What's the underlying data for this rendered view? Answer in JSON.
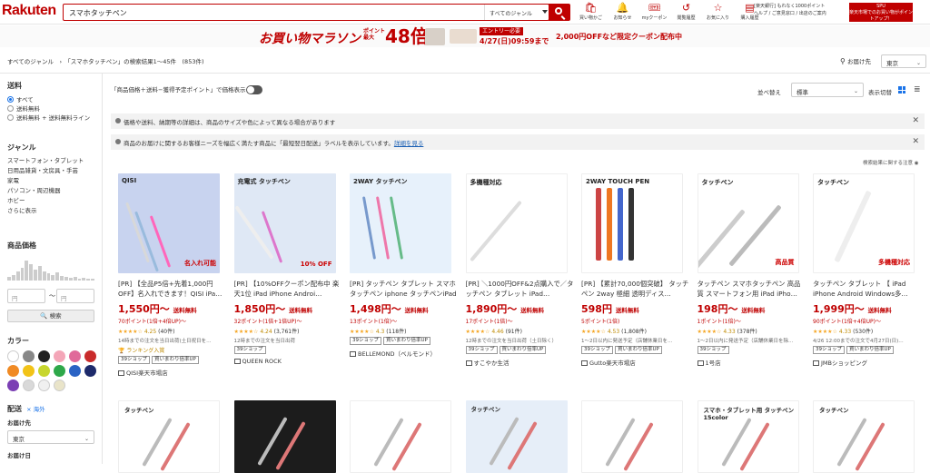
{
  "header": {
    "logo": "Rakuten",
    "search_value": "スマホタッチペン",
    "genre_select": "すべてのジャンル",
    "icons": [
      {
        "name": "purchase-history-icon",
        "glyph": "🛍",
        "label": "買い物かご"
      },
      {
        "name": "bell-icon",
        "glyph": "🔔",
        "label": "お知らせ"
      },
      {
        "name": "coupon-icon",
        "glyph": "🎟",
        "label": "myクーポン"
      },
      {
        "name": "history-icon",
        "glyph": "↺",
        "label": "閲覧履歴"
      },
      {
        "name": "star-icon",
        "glyph": "☆",
        "label": "お気に入り"
      },
      {
        "name": "receipt-icon",
        "glyph": "▤",
        "label": "購入履歴"
      }
    ],
    "links_line1": "[楽天銀行] もれなく1000ポイント",
    "links_line2": "ヘルプ / ご意見窓口 / 出店のご案内",
    "banner": "楽天市場でのお買い物がポイントアップ！",
    "banner_top": "SPU"
  },
  "promo": {
    "title": "お買い物マラソン",
    "point_label1": "ポイント",
    "point_label2": "最大",
    "big": "48倍",
    "entry": "エントリー必要",
    "deadline": "4/27(日)09:59まで",
    "coupon": "2,000円OFFなど限定クーポン配布中"
  },
  "breadcrumb": "すべてのジャンル　›　「スマホタッチペン」の検索結果1〜45件　(853件)",
  "delivery": {
    "label": "お届け先",
    "value": "東京"
  },
  "sidebar": {
    "shipping_title": "送料",
    "shipping_options": [
      "すべて",
      "送料無料",
      "送料無料 + 送料無料ライン"
    ],
    "genre_title": "ジャンル",
    "genres": [
      "スマートフォン・タブレット",
      "日用品雑貨・文房具・手芸",
      "家電",
      "パソコン・周辺機器",
      "ホビー",
      "さらに表示"
    ],
    "price_title": "商品価格",
    "price_min_ph": "円",
    "price_max_ph": "円",
    "price_sep": "〜",
    "search_button": "🔍 検索",
    "color_title": "カラー",
    "colors": [
      "#ffffff",
      "#888888",
      "#222222",
      "#f4a6b8",
      "#e06a9a",
      "#c92b2b",
      "#f08a24",
      "#f2c318",
      "#c7d62e",
      "#2ea84a",
      "#2a63c4",
      "#1d2a6b",
      "#7b3fb4",
      "#d9d9d9",
      "#f0f0f0",
      "#e9e4c9"
    ],
    "delivery_title": "配送",
    "delivery_overseas": "× 海外",
    "ship_to_label": "お届け先",
    "ship_to_value": "東京",
    "ship_date_label": "お届け日"
  },
  "toolbar": {
    "toggle_label": "「商品価格＋送料−獲得予定ポイント」で価格表示",
    "sort_label": "並べ替え",
    "sort_value": "標準",
    "view_label": "表示切替"
  },
  "notices": [
    {
      "text": "価格や送料、納期等の詳細は、商品のサイズや色によって異なる場合があります",
      "link": ""
    },
    {
      "text": "商品のお届けに関するお客様ニーズを幅広く満たす商品に「最短翌日配送」ラベルを表示しています。",
      "link": "詳細を見る"
    }
  ],
  "search_note": "検索結果に関する注意 ◉",
  "products": [
    {
      "title": "[PR] 【全品P5倍+先着1,000円OFF】名入れできます！QISI iPa…",
      "price": "1,550円〜",
      "ship_label": "送料無料",
      "points": "70ポイント(1倍+4倍UP)〜",
      "rating": "4.25",
      "reviews": "(40件)",
      "ship_note": "14時までの注文を当日出荷(土日祝日を…",
      "rank": "🏆 ランキング入賞",
      "tags": [
        "39ショップ",
        "買いまわり倍率UP"
      ],
      "shop": "QISI楽天市場店"
    },
    {
      "title": "[PR] 【10%OFFクーポン配布中 楽天1位 iPad iPhone Androi…",
      "price": "1,850円〜",
      "ship_label": "送料無料",
      "points": "32ポイント(1倍+1倍UP)〜",
      "rating": "4.24",
      "reviews": "(3,761件)",
      "ship_note": "12時までの注文を当日出荷",
      "rank": "",
      "tags": [
        "39ショップ"
      ],
      "shop": "QUEEN ROCK"
    },
    {
      "title": "[PR] タッチペン タブレット スマホ タッチペン iphone タッチペンiPad ペ…",
      "price": "1,498円〜",
      "ship_label": "送料無料",
      "points": "13ポイント(1倍)〜",
      "rating": "4.3",
      "reviews": "(118件)",
      "ship_note": "",
      "rank": "",
      "tags": [
        "39ショップ",
        "買いまわり倍率UP"
      ],
      "shop": "BELLEMOND（ベルモンド）"
    },
    {
      "title": "[PR] ＼1000円OFF&2点購入で／タッチペン タブレット iPad…",
      "price": "1,890円〜",
      "ship_label": "送料無料",
      "points": "17ポイント(1倍)〜",
      "rating": "4.46",
      "reviews": "(91件)",
      "ship_note": "12時までの注文を当日出荷（土日除く）",
      "rank": "",
      "tags": [
        "39ショップ",
        "買いまわり倍率UP"
      ],
      "shop": "すこやか生活"
    },
    {
      "title": "[PR] 【累計70,000個突破】 タッチペン 2way 極細 透明ディス…",
      "price": "598円",
      "ship_label": "送料無料",
      "points": "5ポイント(1倍)",
      "rating": "4.53",
      "reviews": "(1,808件)",
      "ship_note": "1〜2日以内に発送予定（店舗休業日を…",
      "rank": "",
      "tags": [
        "39ショップ",
        "買いまわり倍率UP"
      ],
      "shop": "Gutto楽天市場店"
    },
    {
      "title": "タッチペン スマホタッチペン 高品質 スマートフォン用 iPad iPho…",
      "price": "198円〜",
      "ship_label": "送料無料",
      "points": "1ポイント(1倍)〜",
      "rating": "4.33",
      "reviews": "(378件)",
      "ship_note": "1〜2日以内に発送予定（店舗休業日を除…",
      "rank": "",
      "tags": [
        "39ショップ"
      ],
      "shop": "1号店"
    },
    {
      "title": "タッチペン タブレット 【 iPad iPhone Android Windows多…",
      "price": "1,999円〜",
      "ship_label": "送料無料",
      "points": "90ポイント(1倍+4倍UP)〜",
      "rating": "4.33",
      "reviews": "(530件)",
      "ship_note": "4/26 12:00までの注文で4月27日(日)…",
      "rank": "",
      "tags": [
        "39ショップ",
        "買いまわり倍率UP"
      ],
      "shop": "JMBショッピング"
    }
  ],
  "product_images": [
    {
      "bg": "#c8d3ef",
      "label": "QISI",
      "sub": "名入れ可能"
    },
    {
      "bg": "#dfe8f5",
      "label": "充電式 タッチペン",
      "sub": "10% OFF"
    },
    {
      "bg": "#e7f1fb",
      "label": "2WAY タッチペン",
      "sub": ""
    },
    {
      "bg": "#ffffff",
      "label": "多機種対応",
      "sub": ""
    },
    {
      "bg": "#ffffff",
      "label": "2WAY TOUCH PEN",
      "sub": ""
    },
    {
      "bg": "#ffffff",
      "label": "タッチペン",
      "sub": "高品質"
    },
    {
      "bg": "#ffffff",
      "label": "タッチペン",
      "sub": "多機種対応"
    }
  ],
  "row2_images": [
    {
      "bg": "#ffffff",
      "label": "タッチペン"
    },
    {
      "bg": "#1c1c1c",
      "label": ""
    },
    {
      "bg": "#ffffff",
      "label": ""
    },
    {
      "bg": "#e6eef8",
      "label": "タッチペン"
    },
    {
      "bg": "#ffffff",
      "label": ""
    },
    {
      "bg": "#ffffff",
      "label": "スマホ・タブレット用 タッチペン 15color"
    },
    {
      "bg": "#ffffff",
      "label": "タッチペン"
    }
  ]
}
